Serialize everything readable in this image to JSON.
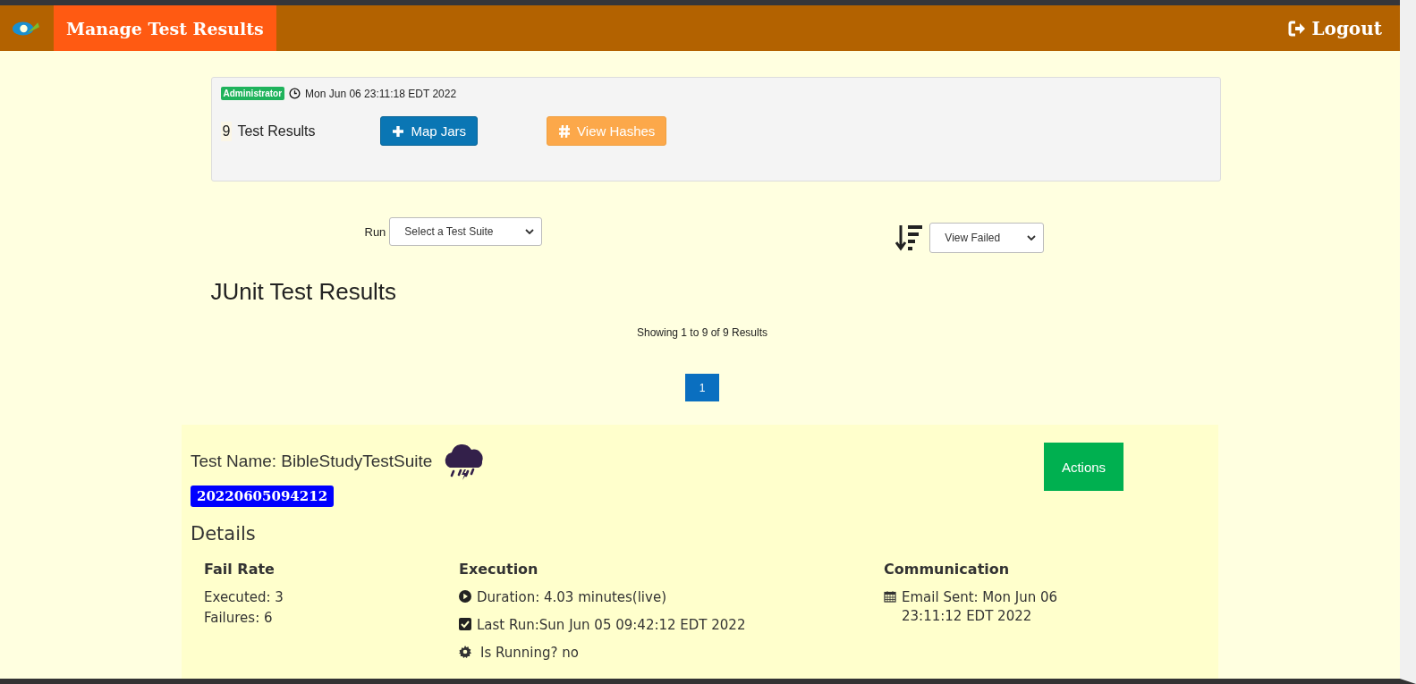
{
  "header": {
    "title": "Manage Test Results",
    "logout": "Logout"
  },
  "info": {
    "role": "Administrator",
    "time": "Mon Jun 06 23:11:18 EDT 2022",
    "count": "9",
    "count_label": "Test Results",
    "buttons": [
      {
        "kind": "map",
        "label": "Map Jars"
      },
      {
        "kind": "hash",
        "label": "View Hashes"
      }
    ]
  },
  "controls": {
    "run_label": "Run",
    "suite": "Select a Test Suite",
    "filter": "View Failed"
  },
  "heading": "JUnit Test Results",
  "showing": "Showing 1 to 9 of 9 Results",
  "pages": [
    {
      "label": "1",
      "selected": true
    }
  ],
  "result": {
    "name": "Test Name: BibleStudyTestSuite",
    "actions": "Actions",
    "id": "20220605094212",
    "details": "Details",
    "columns": [
      {
        "title": "Fail Rate",
        "lines": [
          {
            "kind": "plain",
            "text": "Executed: 3"
          },
          {
            "kind": "plain",
            "text": "Failures: 6"
          }
        ]
      },
      {
        "title": "Execution",
        "lines": [
          {
            "kind": "play",
            "text": "Duration: 4.03 minutes(live)"
          },
          {
            "kind": "check",
            "text": "Last Run:Sun Jun 05 09:42:12 EDT 2022"
          },
          {
            "kind": "gear",
            "text": "Is Running? no"
          }
        ]
      },
      {
        "title": "Communication",
        "lines": [
          {
            "kind": "calendar",
            "text": "Email Sent: Mon Jun 06 23:11:12 EDT 2022"
          }
        ]
      }
    ]
  }
}
